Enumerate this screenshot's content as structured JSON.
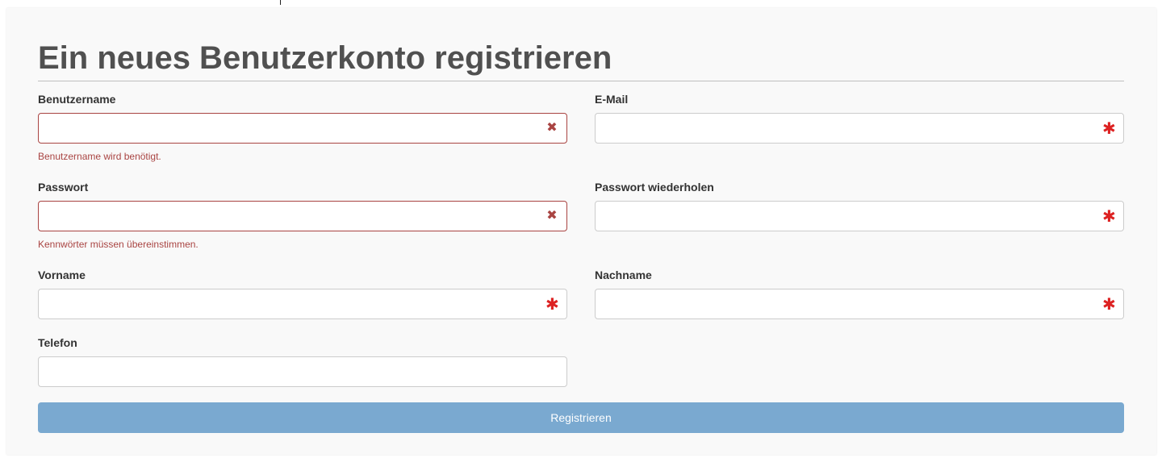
{
  "form": {
    "title": "Ein neues Benutzerkonto registrieren",
    "fields": {
      "username": {
        "label": "Benutzername",
        "value": "",
        "error": "Benutzername wird benötigt."
      },
      "email": {
        "label": "E-Mail",
        "value": ""
      },
      "password": {
        "label": "Passwort",
        "value": "",
        "error": "Kennwörter müssen übereinstimmen."
      },
      "password_repeat": {
        "label": "Passwort wiederholen",
        "value": ""
      },
      "first_name": {
        "label": "Vorname",
        "value": ""
      },
      "last_name": {
        "label": "Nachname",
        "value": ""
      },
      "phone": {
        "label": "Telefon",
        "value": ""
      }
    },
    "icons": {
      "error": "✖",
      "required": "✱"
    },
    "submit_label": "Registrieren"
  },
  "colors": {
    "error": "#a94442",
    "required": "#dd2222",
    "button": "#7aa9d0",
    "title": "#505050"
  }
}
